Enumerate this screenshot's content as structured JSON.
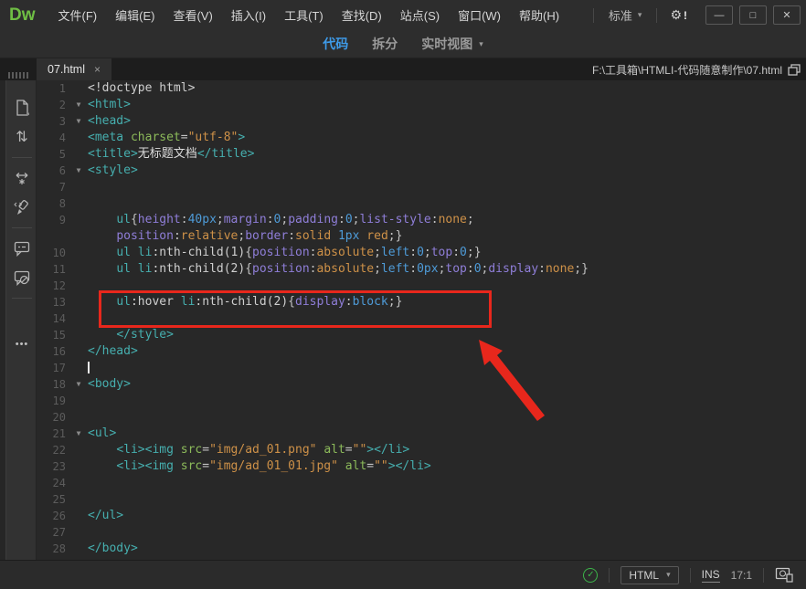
{
  "window": {
    "logo_text": "Dw",
    "menu_items": [
      "文件(F)",
      "编辑(E)",
      "查看(V)",
      "插入(I)",
      "工具(T)",
      "查找(D)",
      "站点(S)",
      "窗口(W)",
      "帮助(H)"
    ],
    "workspace_label": "标准",
    "gear_badge": "!",
    "controls": {
      "minimize": "—",
      "maximize": "□",
      "close": "✕"
    }
  },
  "view_toolbar": {
    "code_label": "代码",
    "split_label": "拆分",
    "live_label": "实时视图",
    "active_tab": "代码"
  },
  "tab_bar": {
    "tab_label": "07.html",
    "close_glyph": "×",
    "file_path": "F:\\工具箱\\HTMLI-代码随意制作\\07.html"
  },
  "icons": {
    "chevron_down": "▾",
    "gear": "⚙",
    "check": "✓",
    "fold": "▼",
    "updown_arrows": "⇅",
    "ellipsis": "•••"
  },
  "status_bar": {
    "doc_type": "HTML",
    "insert_mode": "INS",
    "cursor_position": "17:1"
  },
  "colors": {
    "accent_blue": "#3e9be9",
    "logo_green": "#6fbe44",
    "annotation_red": "#e8271c",
    "status_green": "#3cb54a",
    "syntax": {
      "tag": "#46afaf",
      "attr": "#8cba5a",
      "str": "#ce9148",
      "prop": "#8f7ed8",
      "num": "#4e9bd8",
      "kw": "#ce9148",
      "pun": "#c2c2c2",
      "plain": "#cfcfcf",
      "txt": "#dcdcdc"
    }
  },
  "code": {
    "lines": [
      {
        "n": "1",
        "fold": false,
        "seg": [
          {
            "t": "<!doctype html>",
            "c": "plain"
          }
        ]
      },
      {
        "n": "2",
        "fold": true,
        "seg": [
          {
            "t": "<html>",
            "c": "tag"
          }
        ]
      },
      {
        "n": "3",
        "fold": true,
        "seg": [
          {
            "t": "<head>",
            "c": "tag"
          }
        ]
      },
      {
        "n": "4",
        "fold": false,
        "seg": [
          {
            "t": "<meta ",
            "c": "tag"
          },
          {
            "t": "charset",
            "c": "attr"
          },
          {
            "t": "=",
            "c": "pun"
          },
          {
            "t": "\"utf-8\"",
            "c": "str"
          },
          {
            "t": ">",
            "c": "tag"
          }
        ]
      },
      {
        "n": "5",
        "fold": false,
        "seg": [
          {
            "t": "<title>",
            "c": "tag"
          },
          {
            "t": "无标题文档",
            "c": "txt"
          },
          {
            "t": "</title>",
            "c": "tag"
          }
        ]
      },
      {
        "n": "6",
        "fold": true,
        "seg": [
          {
            "t": "<style>",
            "c": "tag"
          }
        ]
      },
      {
        "n": "7",
        "fold": false,
        "seg": []
      },
      {
        "n": "8",
        "fold": false,
        "seg": []
      },
      {
        "n": "9",
        "fold": false,
        "seg": [
          {
            "t": "    ",
            "c": "pun"
          },
          {
            "t": "ul",
            "c": "tag"
          },
          {
            "t": "{",
            "c": "pun"
          },
          {
            "t": "height",
            "c": "prop"
          },
          {
            "t": ":",
            "c": "pun"
          },
          {
            "t": "40px",
            "c": "num"
          },
          {
            "t": ";",
            "c": "pun"
          },
          {
            "t": "margin",
            "c": "prop"
          },
          {
            "t": ":",
            "c": "pun"
          },
          {
            "t": "0",
            "c": "num"
          },
          {
            "t": ";",
            "c": "pun"
          },
          {
            "t": "padding",
            "c": "prop"
          },
          {
            "t": ":",
            "c": "pun"
          },
          {
            "t": "0",
            "c": "num"
          },
          {
            "t": ";",
            "c": "pun"
          },
          {
            "t": "list-style",
            "c": "prop"
          },
          {
            "t": ":",
            "c": "pun"
          },
          {
            "t": "none",
            "c": "kw"
          },
          {
            "t": ";",
            "c": "pun"
          }
        ]
      },
      {
        "n": "",
        "fold": false,
        "seg": [
          {
            "t": "    ",
            "c": "pun"
          },
          {
            "t": "position",
            "c": "prop"
          },
          {
            "t": ":",
            "c": "pun"
          },
          {
            "t": "relative",
            "c": "kw"
          },
          {
            "t": ";",
            "c": "pun"
          },
          {
            "t": "border",
            "c": "prop"
          },
          {
            "t": ":",
            "c": "pun"
          },
          {
            "t": "solid",
            "c": "kw"
          },
          {
            "t": " ",
            "c": "pun"
          },
          {
            "t": "1px",
            "c": "num"
          },
          {
            "t": " ",
            "c": "pun"
          },
          {
            "t": "red",
            "c": "kw"
          },
          {
            "t": ";",
            "c": "pun"
          },
          {
            "t": "}",
            "c": "pun"
          }
        ]
      },
      {
        "n": "10",
        "fold": false,
        "seg": [
          {
            "t": "    ",
            "c": "pun"
          },
          {
            "t": "ul",
            "c": "tag"
          },
          {
            "t": " ",
            "c": "pun"
          },
          {
            "t": "li",
            "c": "tag"
          },
          {
            "t": ":nth-child(1)",
            "c": "plain"
          },
          {
            "t": "{",
            "c": "pun"
          },
          {
            "t": "position",
            "c": "prop"
          },
          {
            "t": ":",
            "c": "pun"
          },
          {
            "t": "absolute",
            "c": "kw"
          },
          {
            "t": ";",
            "c": "pun"
          },
          {
            "t": "left",
            "c": "num"
          },
          {
            "t": ":",
            "c": "pun"
          },
          {
            "t": "0",
            "c": "num"
          },
          {
            "t": ";",
            "c": "pun"
          },
          {
            "t": "top",
            "c": "prop"
          },
          {
            "t": ":",
            "c": "pun"
          },
          {
            "t": "0",
            "c": "num"
          },
          {
            "t": ";",
            "c": "pun"
          },
          {
            "t": "}",
            "c": "pun"
          }
        ]
      },
      {
        "n": "11",
        "fold": false,
        "seg": [
          {
            "t": "    ",
            "c": "pun"
          },
          {
            "t": "ul",
            "c": "tag"
          },
          {
            "t": " ",
            "c": "pun"
          },
          {
            "t": "li",
            "c": "tag"
          },
          {
            "t": ":nth-child(2)",
            "c": "plain"
          },
          {
            "t": "{",
            "c": "pun"
          },
          {
            "t": "position",
            "c": "prop"
          },
          {
            "t": ":",
            "c": "pun"
          },
          {
            "t": "absolute",
            "c": "kw"
          },
          {
            "t": ";",
            "c": "pun"
          },
          {
            "t": "left",
            "c": "num"
          },
          {
            "t": ":",
            "c": "pun"
          },
          {
            "t": "0px",
            "c": "num"
          },
          {
            "t": ";",
            "c": "pun"
          },
          {
            "t": "top",
            "c": "prop"
          },
          {
            "t": ":",
            "c": "pun"
          },
          {
            "t": "0",
            "c": "num"
          },
          {
            "t": ";",
            "c": "pun"
          },
          {
            "t": "display",
            "c": "prop"
          },
          {
            "t": ":",
            "c": "pun"
          },
          {
            "t": "none",
            "c": "kw"
          },
          {
            "t": ";",
            "c": "pun"
          },
          {
            "t": "}",
            "c": "pun"
          }
        ]
      },
      {
        "n": "12",
        "fold": false,
        "seg": []
      },
      {
        "n": "13",
        "fold": false,
        "seg": [
          {
            "t": "    ",
            "c": "pun"
          },
          {
            "t": "ul",
            "c": "tag"
          },
          {
            "t": ":hover",
            "c": "plain"
          },
          {
            "t": " ",
            "c": "pun"
          },
          {
            "t": "li",
            "c": "tag"
          },
          {
            "t": ":nth-child(2)",
            "c": "plain"
          },
          {
            "t": "{",
            "c": "pun"
          },
          {
            "t": "display",
            "c": "prop"
          },
          {
            "t": ":",
            "c": "pun"
          },
          {
            "t": "block",
            "c": "num"
          },
          {
            "t": ";",
            "c": "pun"
          },
          {
            "t": "}",
            "c": "pun"
          }
        ]
      },
      {
        "n": "14",
        "fold": false,
        "seg": []
      },
      {
        "n": "15",
        "fold": false,
        "seg": [
          {
            "t": "    ",
            "c": "pun"
          },
          {
            "t": "</style>",
            "c": "tag"
          }
        ]
      },
      {
        "n": "16",
        "fold": false,
        "seg": [
          {
            "t": "</head>",
            "c": "tag"
          }
        ]
      },
      {
        "n": "17",
        "fold": false,
        "caret": true,
        "seg": []
      },
      {
        "n": "18",
        "fold": true,
        "seg": [
          {
            "t": "<body>",
            "c": "tag"
          }
        ]
      },
      {
        "n": "19",
        "fold": false,
        "seg": []
      },
      {
        "n": "20",
        "fold": false,
        "seg": []
      },
      {
        "n": "21",
        "fold": true,
        "seg": [
          {
            "t": "<ul>",
            "c": "tag"
          }
        ]
      },
      {
        "n": "22",
        "fold": false,
        "seg": [
          {
            "t": "    ",
            "c": "pun"
          },
          {
            "t": "<li><img ",
            "c": "tag"
          },
          {
            "t": "src",
            "c": "attr"
          },
          {
            "t": "=",
            "c": "pun"
          },
          {
            "t": "\"img/ad_01.png\"",
            "c": "str"
          },
          {
            "t": " ",
            "c": "pun"
          },
          {
            "t": "alt",
            "c": "attr"
          },
          {
            "t": "=",
            "c": "pun"
          },
          {
            "t": "\"\"",
            "c": "str"
          },
          {
            "t": "></li>",
            "c": "tag"
          }
        ]
      },
      {
        "n": "23",
        "fold": false,
        "seg": [
          {
            "t": "    ",
            "c": "pun"
          },
          {
            "t": "<li><img ",
            "c": "tag"
          },
          {
            "t": "src",
            "c": "attr"
          },
          {
            "t": "=",
            "c": "pun"
          },
          {
            "t": "\"img/ad_01_01.jpg\"",
            "c": "str"
          },
          {
            "t": " ",
            "c": "pun"
          },
          {
            "t": "alt",
            "c": "attr"
          },
          {
            "t": "=",
            "c": "pun"
          },
          {
            "t": "\"\"",
            "c": "str"
          },
          {
            "t": "></li>",
            "c": "tag"
          }
        ]
      },
      {
        "n": "24",
        "fold": false,
        "seg": []
      },
      {
        "n": "25",
        "fold": false,
        "seg": []
      },
      {
        "n": "26",
        "fold": false,
        "seg": [
          {
            "t": "</ul>",
            "c": "tag"
          }
        ]
      },
      {
        "n": "27",
        "fold": false,
        "seg": []
      },
      {
        "n": "28",
        "fold": false,
        "seg": [
          {
            "t": "</body>",
            "c": "tag"
          }
        ]
      }
    ]
  },
  "annotation": {
    "arrow_points": "484,284 510,296 504,301 556,367 548,373 496,307 490,312"
  }
}
